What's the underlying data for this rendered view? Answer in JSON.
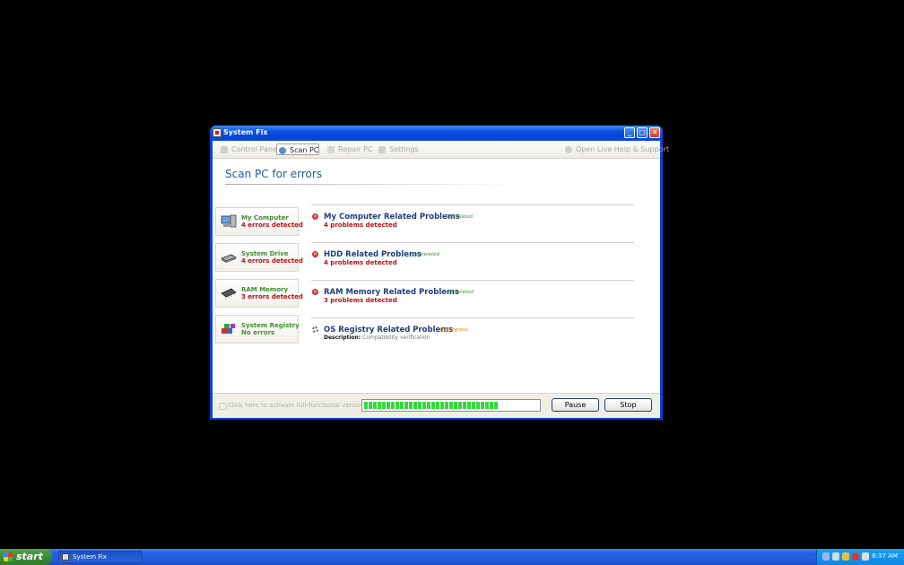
{
  "window": {
    "title": "System Fix"
  },
  "toolbar": {
    "items": [
      {
        "label": "Control Panel",
        "active": false
      },
      {
        "label": "Scan PC",
        "active": true
      },
      {
        "label": "Repair PC",
        "active": false
      },
      {
        "label": "Settings",
        "active": false
      }
    ],
    "help_label": "Open Live Help & Support"
  },
  "heading": "Scan PC for errors",
  "categories": [
    {
      "name": "My Computer",
      "status": "4 errors detected",
      "icon": "computer-icon"
    },
    {
      "name": "System Drive",
      "status": "4 errors detected",
      "icon": "hard-drive-icon"
    },
    {
      "name": "RAM Memory",
      "status": "3 errors detected",
      "icon": "memory-chip-icon"
    },
    {
      "name": "System Registry",
      "status": "No errors",
      "icon": "registry-cubes-icon"
    }
  ],
  "problems": [
    {
      "title": "My Computer Related Problems",
      "state": "Completed",
      "count": "4 problems detected"
    },
    {
      "title": "HDD Related Problems",
      "state": "Completed",
      "count": "4 problems detected"
    },
    {
      "title": "RAM Memory Related Problems",
      "state": "Completed",
      "count": "3 problems detected"
    },
    {
      "title": "OS Registry Related Problems",
      "state": "In Progress",
      "desc_label": "Description:",
      "desc_value": "Compatibility verification"
    }
  ],
  "bottom": {
    "activate_label": "Click here to activate full-functional version",
    "progress_percent": 77,
    "pause_label": "Pause",
    "stop_label": "Stop"
  },
  "taskbar": {
    "start_label": "start",
    "task_label": "System Fix",
    "clock": "6:37 AM"
  },
  "colors": {
    "error": "#bb1111",
    "ok": "#3f8f2f",
    "title_blue": "#1b5fa6",
    "progress": "#33d93b"
  }
}
